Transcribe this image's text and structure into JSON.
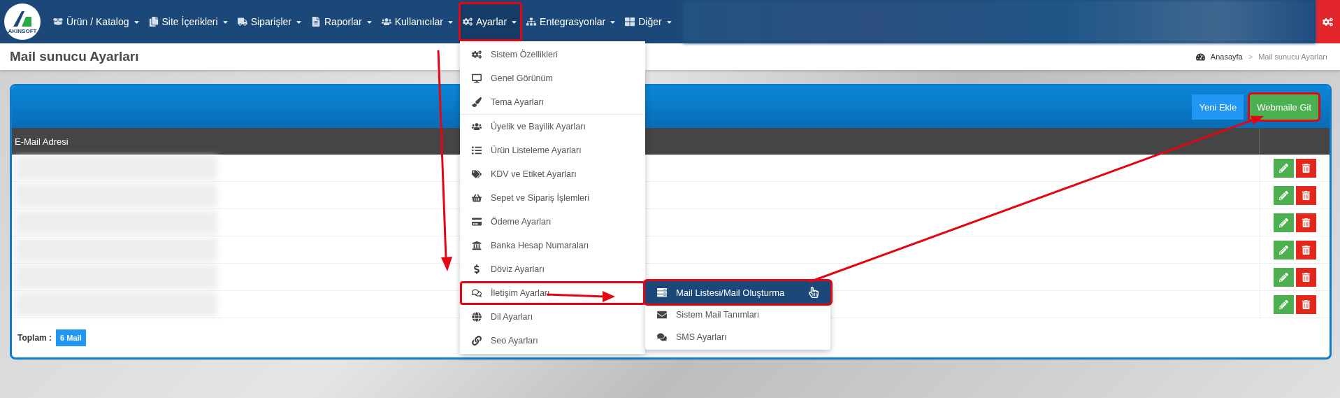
{
  "navbar": {
    "items": [
      {
        "label": "Ürün / Katalog",
        "selected": false,
        "outlined": false
      },
      {
        "label": "Site İçerikleri",
        "selected": false,
        "outlined": false
      },
      {
        "label": "Siparişler",
        "selected": false,
        "outlined": false
      },
      {
        "label": "Raporlar",
        "selected": false,
        "outlined": false
      },
      {
        "label": "Kullanıcılar",
        "selected": false,
        "outlined": false
      },
      {
        "label": "Ayarlar",
        "selected": true,
        "outlined": true
      },
      {
        "label": "Entegrasyonlar",
        "selected": false,
        "outlined": false
      },
      {
        "label": "Diğer",
        "selected": false,
        "outlined": false
      }
    ],
    "logo_text": "AKINSOFT"
  },
  "dropdown": {
    "items": [
      {
        "label": "Sistem Özellikleri",
        "outlined": false
      },
      {
        "label": "Genel Görünüm",
        "outlined": false
      },
      {
        "label": "Tema Ayarları",
        "outlined": false,
        "divider_after": true
      },
      {
        "label": "Üyelik ve Bayilik Ayarları",
        "outlined": false
      },
      {
        "label": "Ürün Listeleme Ayarları",
        "outlined": false
      },
      {
        "label": "KDV ve Etiket Ayarları",
        "outlined": false
      },
      {
        "label": "Sepet ve Sipariş İşlemleri",
        "outlined": false
      },
      {
        "label": "Ödeme Ayarları",
        "outlined": false
      },
      {
        "label": "Banka Hesap Numaraları",
        "outlined": false
      },
      {
        "label": "Döviz Ayarları",
        "outlined": false
      },
      {
        "label": "İletişim Ayarları",
        "outlined": true
      },
      {
        "label": "Dil Ayarları",
        "outlined": false
      },
      {
        "label": "Seo Ayarları",
        "outlined": false
      }
    ],
    "submenu": {
      "items": [
        {
          "label": "Mail Listesi/Mail Oluşturma",
          "selected": true,
          "outlined": true
        },
        {
          "label": "Sistem Mail Tanımları",
          "selected": false,
          "outlined": false
        },
        {
          "label": "SMS Ayarları",
          "selected": false,
          "outlined": false
        }
      ]
    }
  },
  "page": {
    "title": "Mail sunucu Ayarları",
    "breadcrumb": {
      "items": [
        "Anasayfa",
        "Mail sunucu Ayarları"
      ],
      "separator": ">"
    }
  },
  "panel": {
    "buttons": [
      {
        "label": "Yeni Ekle",
        "kind": "primary",
        "outlined": false
      },
      {
        "label": "Webmaile Git",
        "kind": "success",
        "outlined": true
      }
    ],
    "table": {
      "columns": [
        "E-Mail Adresi"
      ],
      "rows": [
        {
          "blurred": true
        },
        {
          "blurred": true
        },
        {
          "blurred": true
        },
        {
          "blurred": true
        },
        {
          "blurred": true
        },
        {
          "blurred": true
        }
      ]
    },
    "footer": {
      "label": "Toplam :",
      "count": "6 Mail"
    }
  }
}
